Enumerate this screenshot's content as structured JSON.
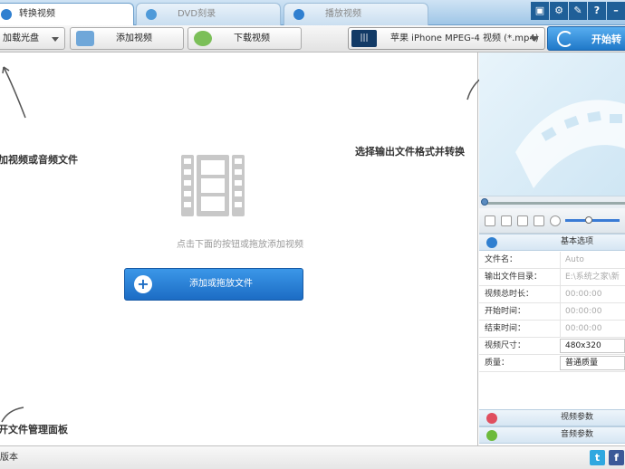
{
  "tabs": [
    {
      "label": "转换视频",
      "active": true
    },
    {
      "label": "DVD刻录",
      "active": false
    },
    {
      "label": "播放视频",
      "active": false
    }
  ],
  "window_buttons": [
    "?"
  ],
  "toolbar": {
    "load_disc_label": "加载光盘",
    "add_video_label": "添加视频",
    "download_video_label": "下载视频",
    "format_label": "苹果 iPhone MPEG-4 视频 (*.mp4)",
    "format_icon_text": "|||",
    "start_label": "开始转"
  },
  "main": {
    "hint_add": "加视频或音频文件",
    "hint_format": "选择输出文件格式并转换",
    "hint_manage": "开文件管理面板",
    "empty_message": "点击下面的按钮或拖放添加视频",
    "add_button_label": "添加或拖放文件"
  },
  "settings": {
    "basic_title": "基本选项",
    "rows": [
      {
        "key": "文件名：",
        "value": "Auto"
      },
      {
        "key": "输出文件目录：",
        "value": "E:\\系统之家\\新"
      },
      {
        "key": "视频总时长：",
        "value": "00:00:00"
      },
      {
        "key": "开始时间：",
        "value": "00:00:00"
      },
      {
        "key": "结束时间：",
        "value": "00:00:00"
      },
      {
        "key": "视频尺寸：",
        "value": "480x320"
      },
      {
        "key": "质量：",
        "value": "普通质量"
      }
    ],
    "video_params_title": "视频参数",
    "audio_params_title": "音频参数"
  },
  "status": {
    "version_label": "版本"
  },
  "colors": {
    "accent": "#1c6cc4",
    "tab_strip": "#9fc6e7"
  }
}
